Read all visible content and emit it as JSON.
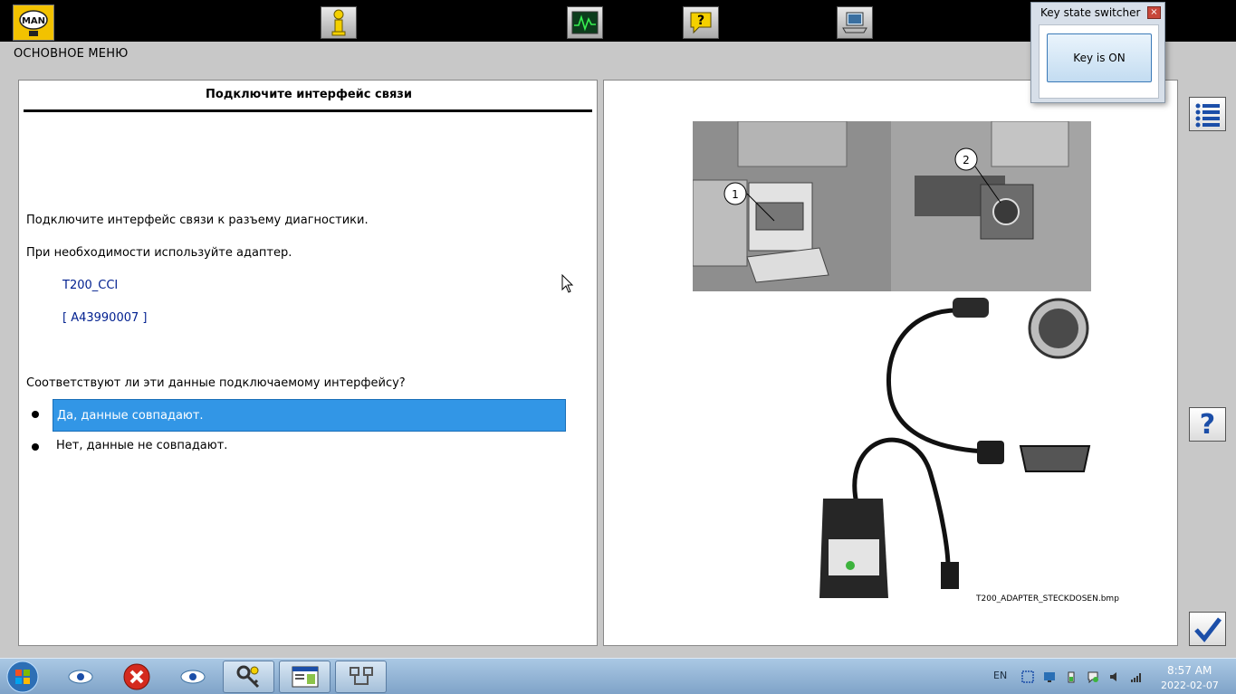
{
  "menu": {
    "title": "ОСНОВНОЕ МЕНЮ"
  },
  "toolbar": {
    "logo_text": "MAN",
    "icons": [
      "man-logo-icon",
      "person-info-icon",
      "oscilloscope-icon",
      "help-question-icon",
      "laptop-icon"
    ]
  },
  "left_panel": {
    "header": "Подключите интерфейс связи",
    "line1": "Подключите интерфейс связи к разъему диагностики.",
    "line2": "При необходимости используйте адаптер.",
    "adapter_name": "T200_CCI",
    "adapter_code": "[ A43990007 ]",
    "question": "Соответствуют ли эти данные подключаемому интерфейсу?",
    "options": [
      {
        "label": "Да, данные совпадают.",
        "selected": true
      },
      {
        "label": "Нет, данные не совпадают.",
        "selected": false
      }
    ]
  },
  "right_panel": {
    "callout_1": "1",
    "callout_2": "2",
    "image_caption": "T200_ADAPTER_STECKDOSEN.bmp"
  },
  "side_buttons": {
    "icons": [
      "list-icon",
      "help-icon",
      "checkmark-icon"
    ],
    "help_glyph": "?"
  },
  "key_dialog": {
    "title": "Key state switcher",
    "close_glyph": "×",
    "button_label": "Key is ON"
  },
  "taskbar": {
    "language": "EN",
    "time": "8:57 AM",
    "date": "2022-02-07"
  },
  "colors": {
    "selection": "#3296e6",
    "code_text": "#001f8f",
    "toolbar_bg": "#000000",
    "logo_bg": "#f2c200"
  }
}
